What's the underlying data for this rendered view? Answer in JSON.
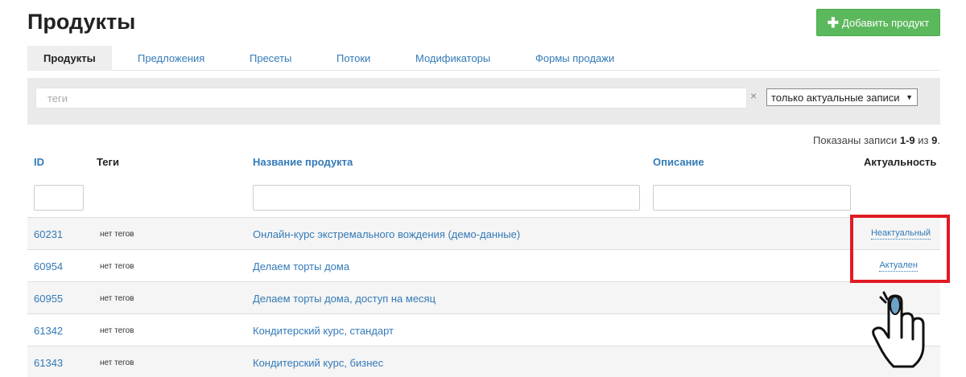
{
  "header": {
    "title": "Продукты",
    "add_button_label": "Добавить продукт",
    "add_button_icon": "plus-icon"
  },
  "tabs": [
    {
      "label": "Продукты",
      "active": true
    },
    {
      "label": "Предложения",
      "active": false
    },
    {
      "label": "Пресеты",
      "active": false
    },
    {
      "label": "Потоки",
      "active": false
    },
    {
      "label": "Модификаторы",
      "active": false
    },
    {
      "label": "Формы продажи",
      "active": false
    }
  ],
  "filters": {
    "tags_placeholder": "теги",
    "clear_symbol": "×",
    "actual_select_value": "только актуальные записи"
  },
  "summary": {
    "prefix": "Показаны записи",
    "range": "1-9",
    "of": "из",
    "total": "9",
    "suffix": "."
  },
  "table": {
    "columns": {
      "id": "ID",
      "tags": "Теги",
      "name": "Название продукта",
      "description": "Описание",
      "status": "Актуальность"
    },
    "rows": [
      {
        "id": "60231",
        "tags": "нет тегов",
        "name": "Онлайн-курс экстремального вождения (демо-данные)",
        "status": "Неактуальный"
      },
      {
        "id": "60954",
        "tags": "нет тегов",
        "name": "Делаем торты дома",
        "status": "Актуален"
      },
      {
        "id": "60955",
        "tags": "нет тегов",
        "name": "Делаем торты дома, доступ на месяц",
        "status": ""
      },
      {
        "id": "61342",
        "tags": "нет тегов",
        "name": "Кондитерский курс, стандарт",
        "status": ""
      },
      {
        "id": "61343",
        "tags": "нет тегов",
        "name": "Кондитерский курс, бизнес",
        "status": ""
      }
    ]
  },
  "colors": {
    "accent": "#337ab7",
    "success": "#5cb85c",
    "highlight": "#e01b24"
  },
  "overlay_icon": "hand-pointer-icon"
}
